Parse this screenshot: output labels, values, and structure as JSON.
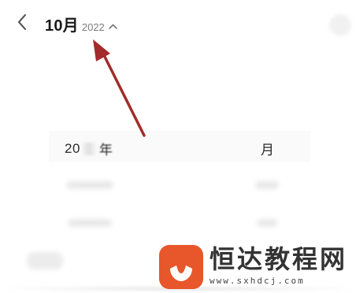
{
  "header": {
    "back_icon": "chevron-left-icon",
    "month_title": "10月",
    "year_label": "2022",
    "expand_icon": "chevron-up-icon"
  },
  "picker": {
    "year_prefix": "20",
    "year_unit": "年",
    "month_unit": "月"
  },
  "annotation": {
    "arrow_color": "#a32b2b"
  },
  "watermark": {
    "brand": "恒达教程网",
    "url": "www.sxhdcj.com",
    "logo_color": "#e8562b"
  },
  "colors": {
    "background": "#ffffff",
    "title_text": "#1a1a1a",
    "secondary_text": "#7b7b7b"
  }
}
